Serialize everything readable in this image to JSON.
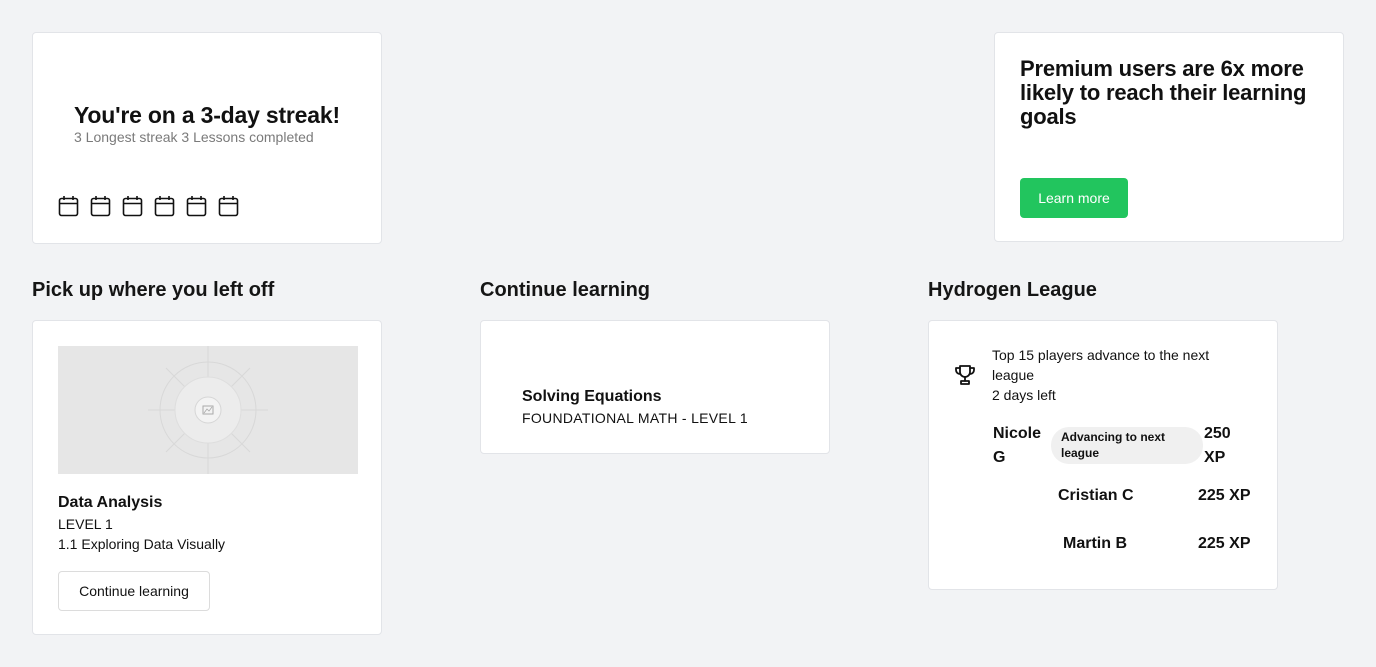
{
  "streak": {
    "title": "You're on a 3-day streak!",
    "subtitle": "3 Longest streak 3 Lessons completed",
    "day_icons": [
      "calendar-icon",
      "calendar-icon",
      "calendar-icon",
      "calendar-icon",
      "calendar-icon",
      "calendar-icon"
    ]
  },
  "premium": {
    "headline": "Premium users are 6x more likely to reach their learning goals",
    "button_label": "Learn more",
    "accent_color": "#22c55e"
  },
  "pickup": {
    "section_title": "Pick up where you left off",
    "course_title": "Data Analysis",
    "level": "LEVEL 1",
    "lesson": "1.1 Exploring Data Visually",
    "button_label": "Continue learning"
  },
  "continue_learning": {
    "section_title": "Continue learning",
    "course_title": "Solving Equations",
    "course_meta": "FOUNDATIONAL MATH - LEVEL 1"
  },
  "league": {
    "section_title": "Hydrogen League",
    "info_line": "Top 15 players advance to the next league",
    "time_left": "2 days left",
    "players": [
      {
        "name": "Nicole G",
        "badge": "Advancing to next league",
        "xp": "250 XP"
      },
      {
        "name": "Cristian C",
        "xp": "225 XP"
      },
      {
        "name": "Martin B",
        "xp": "225 XP"
      }
    ]
  }
}
